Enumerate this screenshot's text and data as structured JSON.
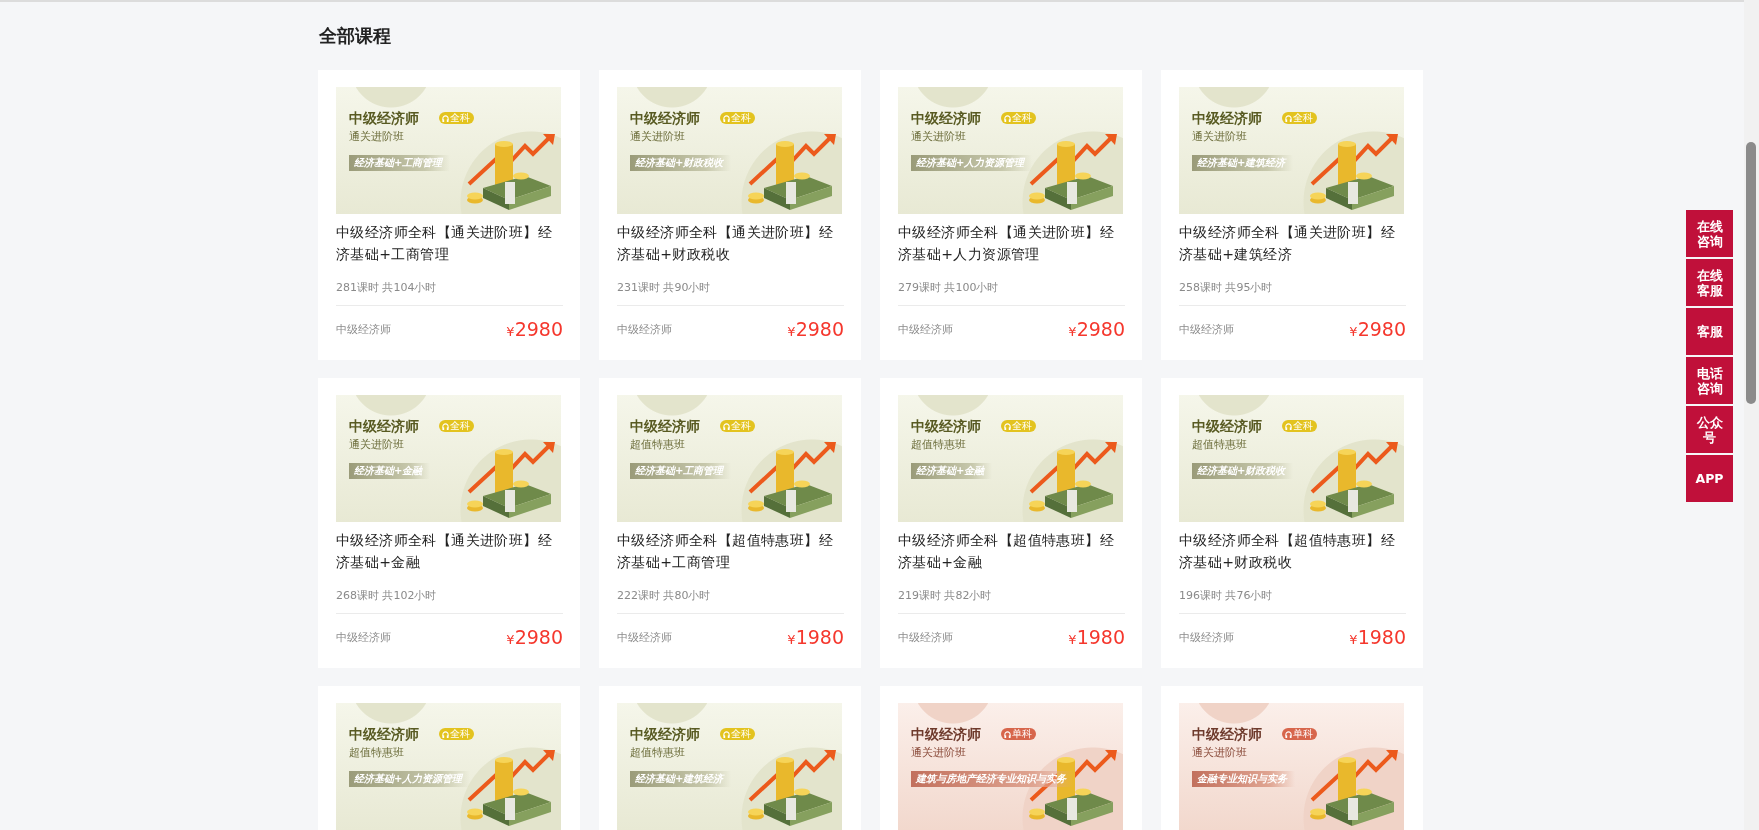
{
  "section_title": "全部课程",
  "courses": [
    {
      "banner": {
        "kind": "green",
        "brand": "中级经济师",
        "tag": "全科",
        "class_name": "通关进阶班",
        "subjects": "经济基础+工商管理"
      },
      "title": "中级经济师全科【通关进阶班】经济基础+工商管理",
      "meta": "281课时 共104小时",
      "category": "中级经济师",
      "currency": "¥",
      "amount": "2980"
    },
    {
      "banner": {
        "kind": "green",
        "brand": "中级经济师",
        "tag": "全科",
        "class_name": "通关进阶班",
        "subjects": "经济基础+财政税收"
      },
      "title": "中级经济师全科【通关进阶班】经济基础+财政税收",
      "meta": "231课时 共90小时",
      "category": "中级经济师",
      "currency": "¥",
      "amount": "2980"
    },
    {
      "banner": {
        "kind": "green",
        "brand": "中级经济师",
        "tag": "全科",
        "class_name": "通关进阶班",
        "subjects": "经济基础+人力资源管理"
      },
      "title": "中级经济师全科【通关进阶班】经济基础+人力资源管理",
      "meta": "279课时 共100小时",
      "category": "中级经济师",
      "currency": "¥",
      "amount": "2980"
    },
    {
      "banner": {
        "kind": "green",
        "brand": "中级经济师",
        "tag": "全科",
        "class_name": "通关进阶班",
        "subjects": "经济基础+建筑经济"
      },
      "title": "中级经济师全科【通关进阶班】经济基础+建筑经济",
      "meta": "258课时 共95小时",
      "category": "中级经济师",
      "currency": "¥",
      "amount": "2980"
    },
    {
      "banner": {
        "kind": "green",
        "brand": "中级经济师",
        "tag": "全科",
        "class_name": "通关进阶班",
        "subjects": "经济基础+金融"
      },
      "title": "中级经济师全科【通关进阶班】经济基础+金融",
      "meta": "268课时 共102小时",
      "category": "中级经济师",
      "currency": "¥",
      "amount": "2980"
    },
    {
      "banner": {
        "kind": "green",
        "brand": "中级经济师",
        "tag": "全科",
        "class_name": "超值特惠班",
        "subjects": "经济基础+工商管理"
      },
      "title": "中级经济师全科【超值特惠班】经济基础+工商管理",
      "meta": "222课时 共80小时",
      "category": "中级经济师",
      "currency": "¥",
      "amount": "1980"
    },
    {
      "banner": {
        "kind": "green",
        "brand": "中级经济师",
        "tag": "全科",
        "class_name": "超值特惠班",
        "subjects": "经济基础+金融"
      },
      "title": "中级经济师全科【超值特惠班】经济基础+金融",
      "meta": "219课时 共82小时",
      "category": "中级经济师",
      "currency": "¥",
      "amount": "1980"
    },
    {
      "banner": {
        "kind": "green",
        "brand": "中级经济师",
        "tag": "全科",
        "class_name": "超值特惠班",
        "subjects": "经济基础+财政税收"
      },
      "title": "中级经济师全科【超值特惠班】经济基础+财政税收",
      "meta": "196课时 共76小时",
      "category": "中级经济师",
      "currency": "¥",
      "amount": "1980"
    },
    {
      "banner": {
        "kind": "green",
        "brand": "中级经济师",
        "tag": "全科",
        "class_name": "超值特惠班",
        "subjects": "经济基础+人力资源管理"
      }
    },
    {
      "banner": {
        "kind": "green",
        "brand": "中级经济师",
        "tag": "全科",
        "class_name": "超值特惠班",
        "subjects": "经济基础+建筑经济"
      }
    },
    {
      "banner": {
        "kind": "pink",
        "brand": "中级经济师",
        "tag": "单科",
        "class_name": "通关进阶班",
        "subjects": "建筑与房地产经济专业知识与实务"
      }
    },
    {
      "banner": {
        "kind": "pink",
        "brand": "中级经济师",
        "tag": "单科",
        "class_name": "通关进阶班",
        "subjects": "金融专业知识与实务"
      }
    }
  ],
  "side_buttons": [
    "在线咨询",
    "在线客服",
    "客服",
    "电话咨询",
    "公众号",
    "APP"
  ]
}
